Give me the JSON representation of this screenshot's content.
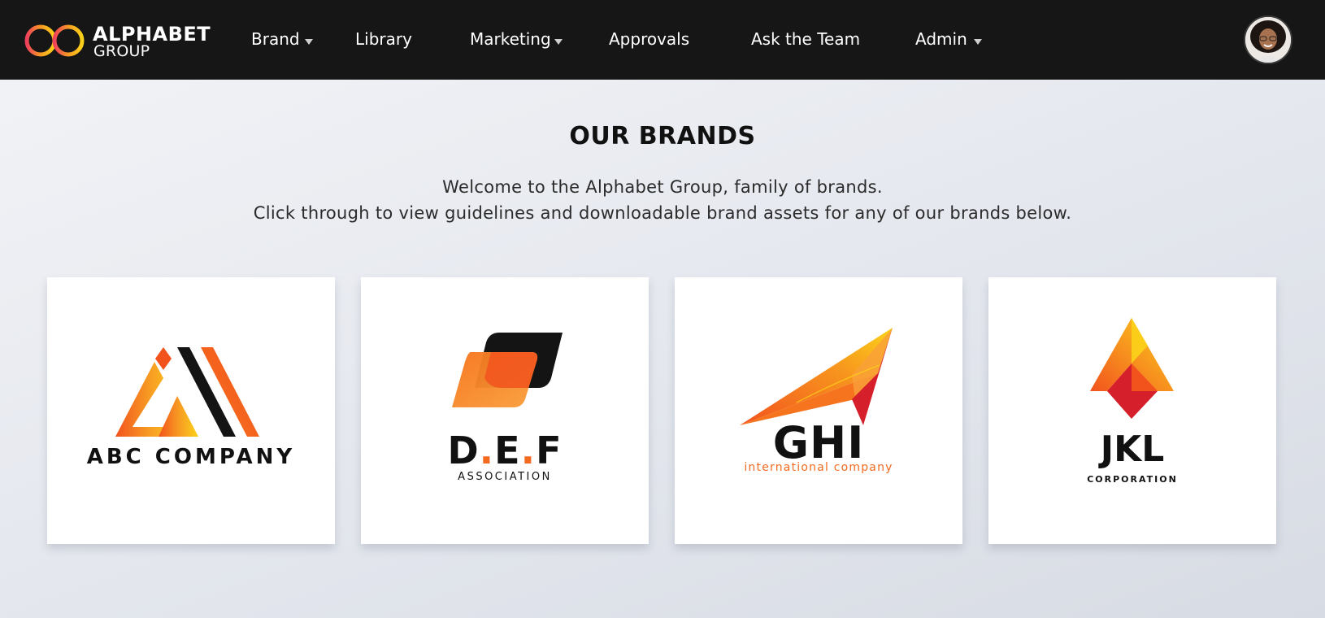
{
  "header": {
    "logo": {
      "word1": "ALPHABET",
      "word2": "GROUP"
    },
    "nav": [
      {
        "label": "Brand",
        "has_dropdown": true
      },
      {
        "label": "Library",
        "has_dropdown": false
      },
      {
        "label": "Marketing",
        "has_dropdown": true
      },
      {
        "label": "Approvals",
        "has_dropdown": false
      },
      {
        "label": "Ask the Team",
        "has_dropdown": false
      },
      {
        "label": "Admin",
        "has_dropdown": true
      }
    ],
    "avatar_icon": "user-avatar"
  },
  "main": {
    "title": "OUR BRANDS",
    "intro_line1": "Welcome to the Alphabet Group, family of brands.",
    "intro_line2": "Click through to view guidelines and downloadable brand assets for any of our brands below.",
    "brands": [
      {
        "name": "ABC COMPANY",
        "subtitle": "",
        "icon": "mountain-logo"
      },
      {
        "name_parts": [
          "D",
          ".",
          "E",
          ".",
          "F"
        ],
        "subtitle": "ASSOCIATION",
        "icon": "parallelogram-logo"
      },
      {
        "name": "GHI",
        "subtitle": "international company",
        "icon": "paper-plane-logo"
      },
      {
        "name": "JKL",
        "subtitle": "CORPORATION",
        "icon": "arrow-diamond-logo"
      }
    ]
  },
  "colors": {
    "topbar": "#161616",
    "accent_orange": "#f26b21",
    "accent_yellow": "#fbd21a",
    "accent_red": "#d51f2a",
    "text_dark": "#111111"
  }
}
